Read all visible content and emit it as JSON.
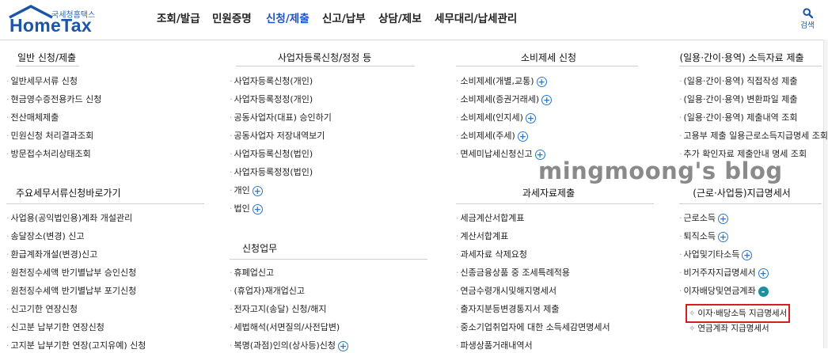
{
  "header": {
    "logo_sub": "국세청홈택스",
    "logo_main": "HomeTax",
    "nav": [
      "조회/발급",
      "민원증명",
      "신청/제출",
      "신고/납부",
      "상담/제보",
      "세무대리/납세관리"
    ],
    "active_nav": "신청/제출",
    "search_label": "검색"
  },
  "columns": [
    {
      "sections": [
        {
          "title": "일반 신청/제출",
          "items": [
            {
              "label": "일반세무서류 신청"
            },
            {
              "label": "현금영수증전용카드 신청"
            },
            {
              "label": "전산매체제출"
            },
            {
              "label": "민원신청 처리결과조회"
            },
            {
              "label": "방문접수처리상태조회"
            }
          ]
        },
        {
          "title": "주요세무서류신청바로가기",
          "items": [
            {
              "label": "사업용(공익법인용)계좌 개설관리"
            },
            {
              "label": "송달장소(변경) 신고"
            },
            {
              "label": "환급계좌개설(변경)신고"
            },
            {
              "label": "원천징수세액 반기별납부 승인신청"
            },
            {
              "label": "원천징수세액 반기별납부 포기신청"
            },
            {
              "label": "신고기한 연장신청"
            },
            {
              "label": "신고분 납부기한 연장신청"
            },
            {
              "label": "고지분 납부기한 연장(고지유예) 신청"
            }
          ]
        }
      ]
    },
    {
      "sections": [
        {
          "title": "사업자등록신청/정정 등",
          "items": [
            {
              "label": "사업자등록신청(개인)"
            },
            {
              "label": "사업자등록정정(개인)"
            },
            {
              "label": "공동사업자(대표) 승인하기"
            },
            {
              "label": "공동사업자 저장내역보기"
            },
            {
              "label": "사업자등록신청(법인)"
            },
            {
              "label": "사업자등록정정(법인)"
            },
            {
              "label": "개인",
              "expand": "+"
            },
            {
              "label": "법인",
              "expand": "+"
            }
          ]
        },
        {
          "title": "신청업무",
          "items": [
            {
              "label": "휴폐업신고"
            },
            {
              "label": "(휴업자)재개업신고"
            },
            {
              "label": "전자고지(송달) 신청/해지"
            },
            {
              "label": "세법해석(서면질의/사전답변)"
            },
            {
              "label": "복명(과점)인의(상사등)신청",
              "expand": "+"
            }
          ]
        }
      ]
    },
    {
      "sections": [
        {
          "title": "소비제세 신청",
          "items": [
            {
              "label": "소비제세(개별,교통)",
              "expand": "+"
            },
            {
              "label": "소비제세(증권거래세)",
              "expand": "+"
            },
            {
              "label": "소비제세(인지세)",
              "expand": "+"
            },
            {
              "label": "소비제세(주세)",
              "expand": "+"
            },
            {
              "label": "면세미납세신청신고",
              "expand": "+"
            }
          ]
        },
        {
          "title": "과세자료제출",
          "items": [
            {
              "label": "세금계산서합계표"
            },
            {
              "label": "계산서합계표"
            },
            {
              "label": "과세자료 삭제요청"
            },
            {
              "label": "신종금융상품 중 조세특례적용"
            },
            {
              "label": "연금수령개시및해지명세서"
            },
            {
              "label": "출자지분등변경통지서 제출"
            },
            {
              "label": "중소기업취업자에 대한 소득세감면명세서"
            },
            {
              "label": "파생상품거래내역서"
            }
          ]
        }
      ]
    },
    {
      "sections": [
        {
          "title": "(일용·간이·용역) 소득자료 제출",
          "items": [
            {
              "label": "(일용·간이·용역) 직접작성 제출"
            },
            {
              "label": "(일용·간이·용역) 변환파일 제출"
            },
            {
              "label": "(일용·간이·용역) 제출내역 조회"
            },
            {
              "label": "고용부 제출 일용근로소득지급명세 조회"
            },
            {
              "label": "추가 확인자료 제출안내 명세 조회"
            }
          ]
        },
        {
          "title": "(근로·사업등)지급명세서",
          "items": [
            {
              "label": "근로소득",
              "expand": "+"
            },
            {
              "label": "퇴직소득",
              "expand": "+"
            },
            {
              "label": "사업및기타소득",
              "expand": "+"
            },
            {
              "label": "비거주자지급명세서",
              "expand": "+"
            },
            {
              "label": "이자배당및연금계좌",
              "expand": "-"
            }
          ],
          "sub_items": [
            {
              "label": "이자·배당소득 지급명세서",
              "highlighted": true
            },
            {
              "label": "연금계좌 지급명세서",
              "highlighted": false
            }
          ]
        }
      ]
    }
  ],
  "watermark": "mingmoong's blog",
  "colors": {
    "brand_blue": "#1a55a8",
    "active_nav": "#1a55c0",
    "plus_icon": "#2a78c6",
    "minus_icon": "#1c8fa0",
    "highlight_box": "#d22020"
  }
}
